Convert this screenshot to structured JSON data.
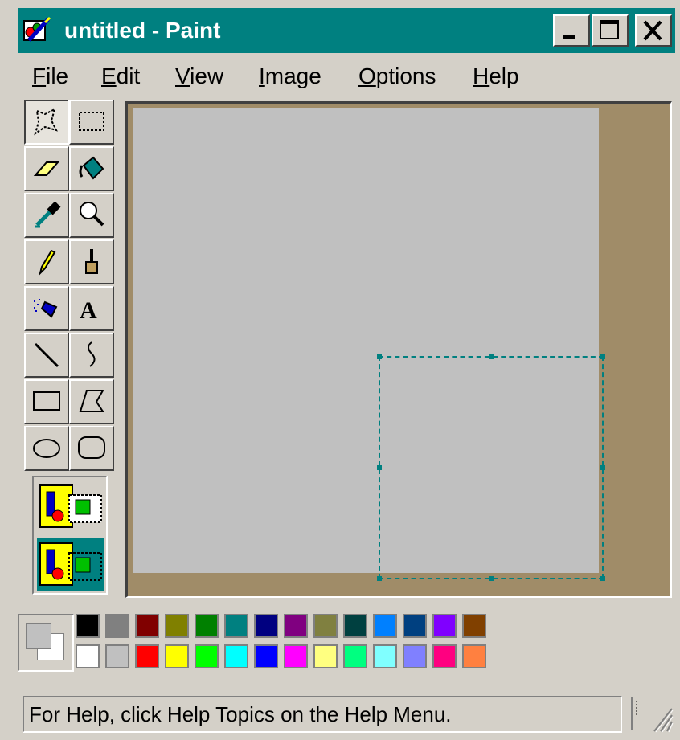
{
  "window": {
    "title": "untitled - Paint",
    "buttons": {
      "minimize": "_",
      "maximize": "□",
      "close": "✕"
    }
  },
  "menu": {
    "items": [
      {
        "key": "F",
        "rest": "ile"
      },
      {
        "key": "E",
        "rest": "dit"
      },
      {
        "key": "V",
        "rest": "iew"
      },
      {
        "key": "I",
        "rest": "mage"
      },
      {
        "key": "O",
        "rest": "ptions"
      },
      {
        "key": "H",
        "rest": "elp"
      }
    ]
  },
  "tools": [
    {
      "name": "free-form-select-icon",
      "pressed": true
    },
    {
      "name": "rect-select-icon",
      "pressed": false
    },
    {
      "name": "eraser-icon",
      "pressed": false
    },
    {
      "name": "fill-bucket-icon",
      "pressed": false
    },
    {
      "name": "color-picker-icon",
      "pressed": false
    },
    {
      "name": "magnifier-icon",
      "pressed": false
    },
    {
      "name": "pencil-icon",
      "pressed": false
    },
    {
      "name": "brush-icon",
      "pressed": false
    },
    {
      "name": "airbrush-icon",
      "pressed": false
    },
    {
      "name": "text-icon",
      "label": "A",
      "pressed": false
    },
    {
      "name": "line-icon",
      "pressed": false
    },
    {
      "name": "curve-icon",
      "pressed": false
    },
    {
      "name": "rectangle-icon",
      "pressed": false
    },
    {
      "name": "polygon-icon",
      "pressed": false
    },
    {
      "name": "ellipse-icon",
      "pressed": false
    },
    {
      "name": "rounded-rect-icon",
      "pressed": false
    }
  ],
  "tool_options": [
    {
      "name": "opaque-selection-icon",
      "selected": false
    },
    {
      "name": "transparent-selection-icon",
      "selected": true
    }
  ],
  "colors": {
    "foreground": "#c0c0c0",
    "background": "#ffffff",
    "palette_top": [
      "#000000",
      "#808080",
      "#800000",
      "#808000",
      "#008000",
      "#008080",
      "#000080",
      "#800080",
      "#808040",
      "#004040",
      "#0080ff",
      "#004080",
      "#8000ff",
      "#804000"
    ],
    "palette_bottom": [
      "#ffffff",
      "#c0c0c0",
      "#ff0000",
      "#ffff00",
      "#00ff00",
      "#00ffff",
      "#0000ff",
      "#ff00ff",
      "#ffff80",
      "#00ff80",
      "#80ffff",
      "#8080ff",
      "#ff0080",
      "#ff8040"
    ],
    "accent": "#008080",
    "workspace": "#a08c68",
    "canvas": "#c0c0c0"
  },
  "status": {
    "text": "For Help, click Help Topics on the Help Menu."
  }
}
